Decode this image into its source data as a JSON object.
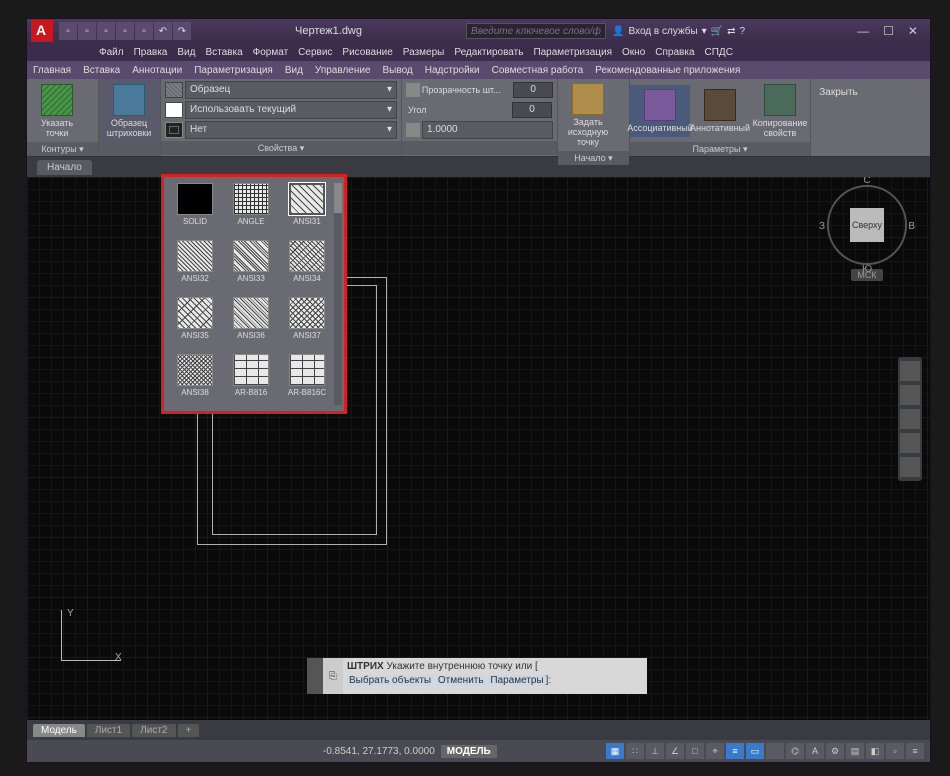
{
  "titlebar": {
    "filename": "Чертеж1.dwg",
    "search_placeholder": "Введите ключевое слово/фразу",
    "login": "Вход в службы"
  },
  "topmenu": [
    "Файл",
    "Правка",
    "Вид",
    "Вставка",
    "Формат",
    "Сервис",
    "Рисование",
    "Размеры",
    "Редактировать",
    "Параметризация",
    "Окно",
    "Справка",
    "СПДС"
  ],
  "ribbon_tabs": [
    "Главная",
    "Вставка",
    "Аннотации",
    "Параметризация",
    "Вид",
    "Управление",
    "Вывод",
    "Надстройки",
    "Совместная работа",
    "Рекомендованные приложения"
  ],
  "ribbon": {
    "pick_points": "Указать точки",
    "pattern": "Образец штриховки",
    "panel1_title": "Контуры ▾",
    "props": {
      "pattern_label": "Образец",
      "color_label": "Использовать текущий",
      "bg_label": "Нет",
      "title": "Свойства ▾"
    },
    "trans": {
      "transparency": "Прозрачность шт...",
      "transparency_val": "0",
      "angle": "Угол",
      "angle_val": "0",
      "scale_val": "1.0000"
    },
    "origin": "Задать исходную точку",
    "origin_title": "Начало ▾",
    "assoc": "Ассоциативный",
    "annot": "Аннотативный",
    "copy": "Копирование свойств",
    "options_title": "Параметры ▾",
    "close": "Закрыть"
  },
  "filetab": "Начало",
  "hatch_patterns": [
    {
      "name": "SOLID",
      "cls": "sw-solid"
    },
    {
      "name": "ANGLE",
      "cls": "sw-angle"
    },
    {
      "name": "ANSI31",
      "cls": "sw-a31",
      "sel": true
    },
    {
      "name": "ANSI32",
      "cls": "sw-a32"
    },
    {
      "name": "ANSI33",
      "cls": "sw-a33"
    },
    {
      "name": "ANSI34",
      "cls": "sw-a34"
    },
    {
      "name": "ANSI35",
      "cls": "sw-a35"
    },
    {
      "name": "ANSI36",
      "cls": "sw-a36"
    },
    {
      "name": "ANSI37",
      "cls": "sw-a37"
    },
    {
      "name": "ANSI38",
      "cls": "sw-a38"
    },
    {
      "name": "AR-B816",
      "cls": "sw-brick"
    },
    {
      "name": "AR-B816C",
      "cls": "sw-brick"
    }
  ],
  "viewcube": {
    "top": "Сверху",
    "n": "С",
    "s": "Ю",
    "e": "В",
    "w": "З",
    "csys": "МСК"
  },
  "ucs": {
    "x": "X",
    "y": "Y"
  },
  "cmdline": {
    "cmd": "ШТРИХ",
    "prompt": "Укажите внутреннюю точку или [",
    "opt1": "Выбрать объекты",
    "opt2": "Отменить",
    "opt3": "Параметры",
    "close": "]:"
  },
  "layout_tabs": {
    "model": "Модель",
    "l1": "Лист1",
    "l2": "Лист2",
    "add": "+"
  },
  "statusbar": {
    "coords": "-0.8541, 27.1773, 0.0000",
    "mode": "МОДЕЛЬ"
  }
}
